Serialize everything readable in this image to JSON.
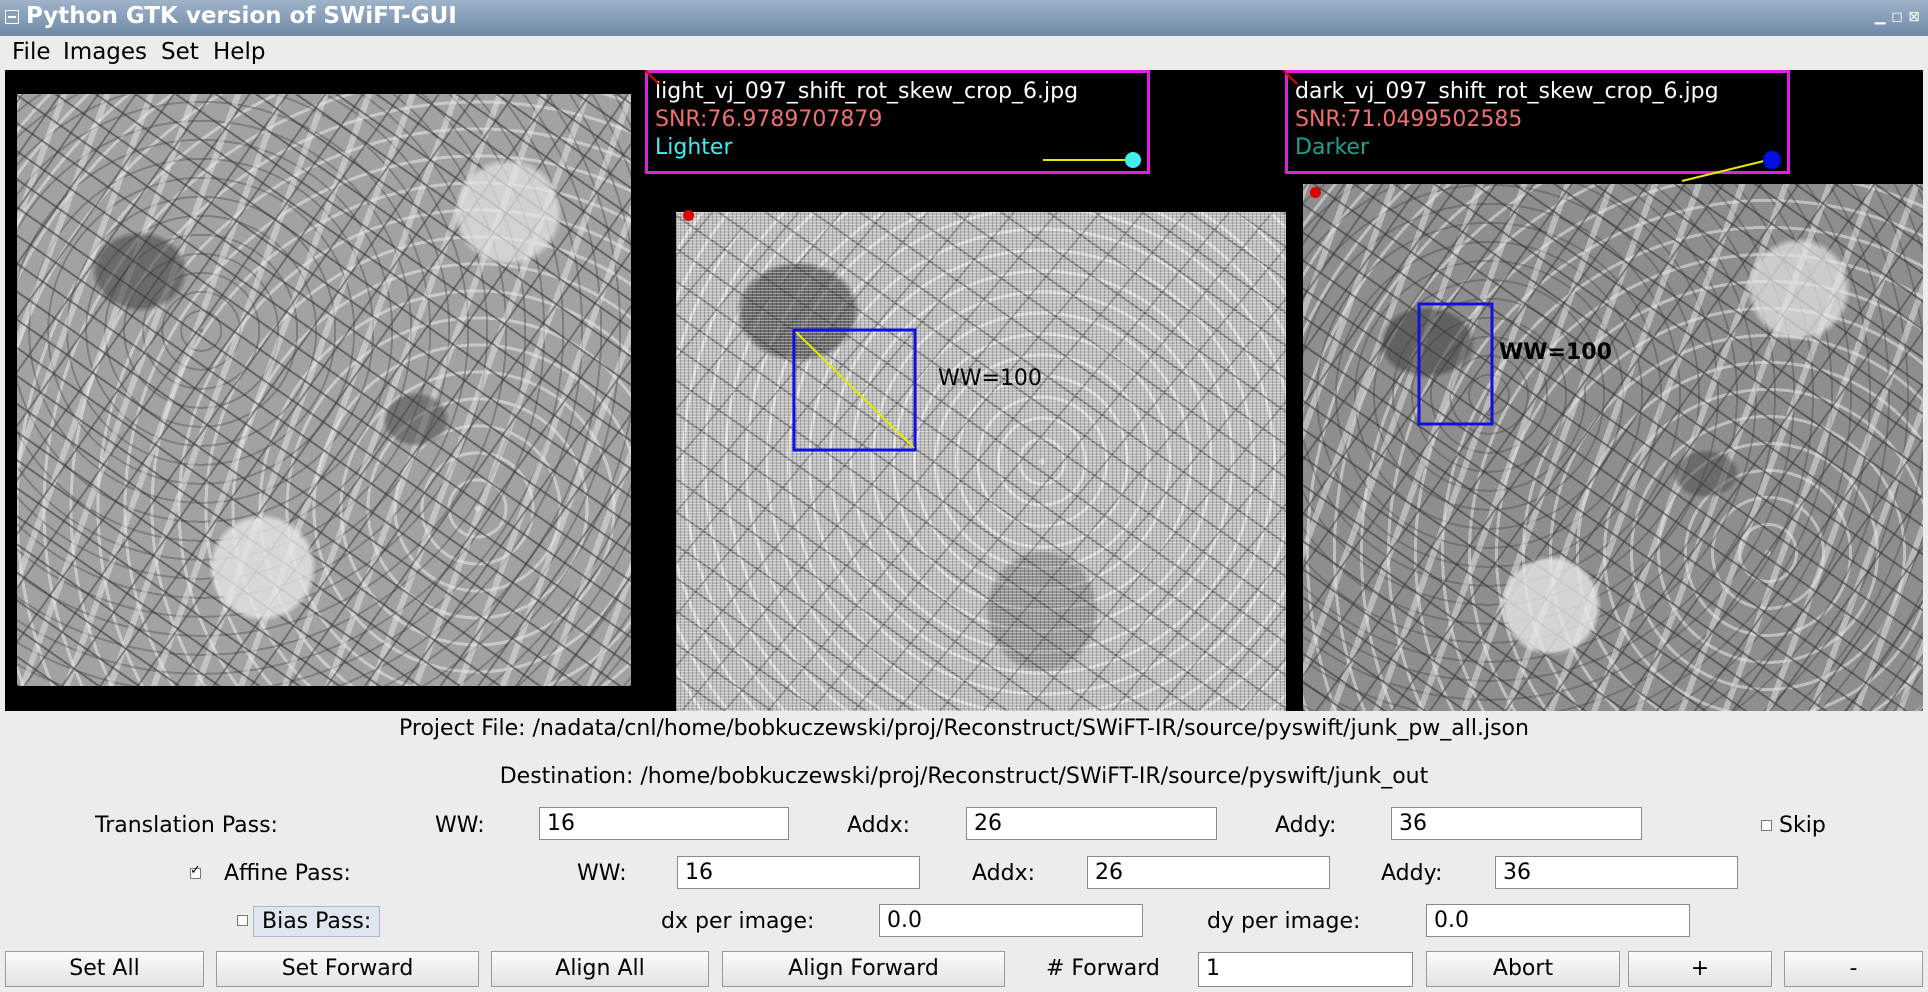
{
  "window": {
    "title": "Python GTK version of SWiFT-GUI",
    "controls": [
      "▁",
      "◻",
      "⊠"
    ]
  },
  "menu": [
    "File",
    "Images",
    "Set",
    "Help"
  ],
  "panels": {
    "left": {},
    "middle": {
      "filename": "light_vj_097_shift_rot_skew_crop_6.jpg",
      "snr": "SNR:76.9789707879",
      "role": "Lighter",
      "role_color": "#40f0f0",
      "ww_label": "WW=100"
    },
    "right": {
      "filename": "dark_vj_097_shift_rot_skew_crop_6.jpg",
      "snr": "SNR:71.0499502585",
      "role": "Darker",
      "role_color": "#20a090",
      "ww_label": "WW=100"
    }
  },
  "project_file": "Project File: /nadata/cnl/home/bobkuczewski/proj/Reconstruct/SWiFT-IR/source/pyswift/junk_pw_all.json",
  "destination": "Destination: /home/bobkuczewski/proj/Reconstruct/SWiFT-IR/source/pyswift/junk_out",
  "translation": {
    "label": "Translation Pass:",
    "ww_label": "WW:",
    "ww": "16",
    "addx_label": "Addx:",
    "addx": "26",
    "addy_label": "Addy:",
    "addy": "36",
    "skip_label": "Skip",
    "skip_checked": false
  },
  "affine": {
    "label": "Affine Pass:",
    "checked": true,
    "ww_label": "WW:",
    "ww": "16",
    "addx_label": "Addx:",
    "addx": "26",
    "addy_label": "Addy:",
    "addy": "36"
  },
  "bias": {
    "label": "Bias Pass:",
    "checked": false,
    "dx_label": "dx per image:",
    "dx": "0.0",
    "dy_label": "dy per image:",
    "dy": "0.0"
  },
  "buttons": {
    "set_all": "Set All",
    "set_forward": "Set Forward",
    "align_all": "Align All",
    "align_forward": "Align Forward",
    "forward_label": "# Forward",
    "forward_value": "1",
    "abort": "Abort",
    "plus": "+",
    "minus": "-"
  },
  "colors": {
    "window_bg": "#ececec",
    "view_bg": "#000000",
    "info_border": "#e020e0",
    "snr_text": "#f07070",
    "window_box": "#1010e0",
    "match_line": "#e8e800",
    "light_marker": "#40f0f0",
    "dark_marker": "#0010e0",
    "anchor_point": "#e00000"
  }
}
